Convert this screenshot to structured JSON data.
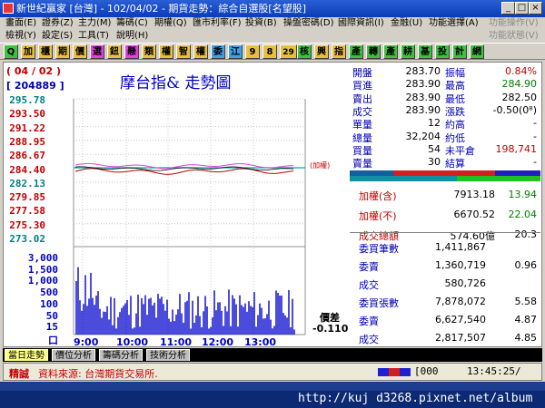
{
  "window": {
    "title": "新世紀贏家 [台灣] - 102/04/02 - 期貨走勢：綜合自選股[名望股]"
  },
  "menu": {
    "row1": [
      "畫面(E)",
      "證券(Z)",
      "主力(M)",
      "籌碼(C)",
      "期權(Q)",
      "匯市利率(F)",
      "投資(B)",
      "操盤密碼(D)",
      "國際資訊(I)",
      "金融(U)",
      "功能選擇(A)",
      "功能操作(V)"
    ],
    "row2": [
      "檢視(Y)",
      "設定(S)",
      "工具(T)",
      "說明(H)",
      "功能狀態(V)"
    ]
  },
  "toolbar": {
    "buttons": [
      "Q",
      "加",
      "櫃",
      "期",
      "價",
      "選",
      "鈕",
      "懸",
      "類",
      "權",
      "智",
      "權",
      "委",
      "江",
      "9",
      "8",
      "29",
      "核",
      "興",
      "指",
      "產",
      "轉",
      "產",
      "耕",
      "基",
      "投",
      "計",
      "網"
    ]
  },
  "chart": {
    "date_label": "( 04 / 02 )",
    "code_label": "[ 204889 ]",
    "title": "摩台指&  走勢圖",
    "weight_tag": "(加權)",
    "price_ticks": [
      "295.78",
      "293.50",
      "291.22",
      "288.95",
      "286.67",
      "284.40",
      "282.13",
      "279.85",
      "277.58",
      "275.30",
      "273.02"
    ],
    "volume_ticks": [
      "3,000",
      "1,500",
      "1,000",
      "500",
      "100",
      "50",
      "15",
      "口"
    ],
    "time_ticks": [
      "9:00",
      "10:00",
      "11:00",
      "12:00",
      "13:00"
    ],
    "spread_label": "價差",
    "spread_value": "-0.110"
  },
  "quote": {
    "rows": [
      {
        "l1": "開盤",
        "v1": "283.70",
        "l2": "振幅",
        "v2": "0.84%"
      },
      {
        "l1": "買進",
        "v1": "283.90",
        "l2": "最高",
        "v2": "284.90"
      },
      {
        "l1": "賣出",
        "v1": "283.90",
        "l2": "最低",
        "v2": "282.50"
      },
      {
        "l1": "成交",
        "v1": "283.90",
        "l2": "漲跌",
        "v2": "-0.50(0⁸)"
      },
      {
        "l1": "單量",
        "v1": "12",
        "l2": "約高",
        "v2": "-"
      },
      {
        "l1": "總量",
        "v1": "32,204",
        "l2": "約低",
        "v2": "-"
      },
      {
        "l1": "買量",
        "v1": "54",
        "l2": "未平倉",
        "v2": "198,741"
      },
      {
        "l1": "賣量",
        "v1": "30",
        "l2": "結算",
        "v2": "-"
      }
    ],
    "index_rows": [
      {
        "label": "加權(含)",
        "value": "7913.18",
        "change": "13.94"
      },
      {
        "label": "加權(不)",
        "value": "6670.52",
        "change": "22.04"
      },
      {
        "label": "成交總額",
        "value": "574.60億",
        "change": "20.3"
      }
    ],
    "stat_rows": [
      {
        "label": "委買筆數",
        "value": "1,411,867",
        "change": ""
      },
      {
        "label": "委賣",
        "value": "1,360,719",
        "change": "0.96"
      },
      {
        "label": "成交",
        "value": "580,726",
        "change": ""
      },
      {
        "label": "委買張數",
        "value": "7,878,072",
        "change": "5.58"
      },
      {
        "label": "委賣",
        "value": "6,627,540",
        "change": "4.87"
      },
      {
        "label": "成交",
        "value": "2,817,507",
        "change": "4.85"
      }
    ]
  },
  "tabs": [
    "當日走勢",
    "價位分析",
    "籌碼分析",
    "技術分析"
  ],
  "status": {
    "app": "精誠",
    "source": "資料來源: 台灣期貨交易所.",
    "counter": "[000",
    "time": "13:45:25/"
  },
  "taskbar": {
    "url": "http://kuj d3268.pixnet.net/album"
  }
}
